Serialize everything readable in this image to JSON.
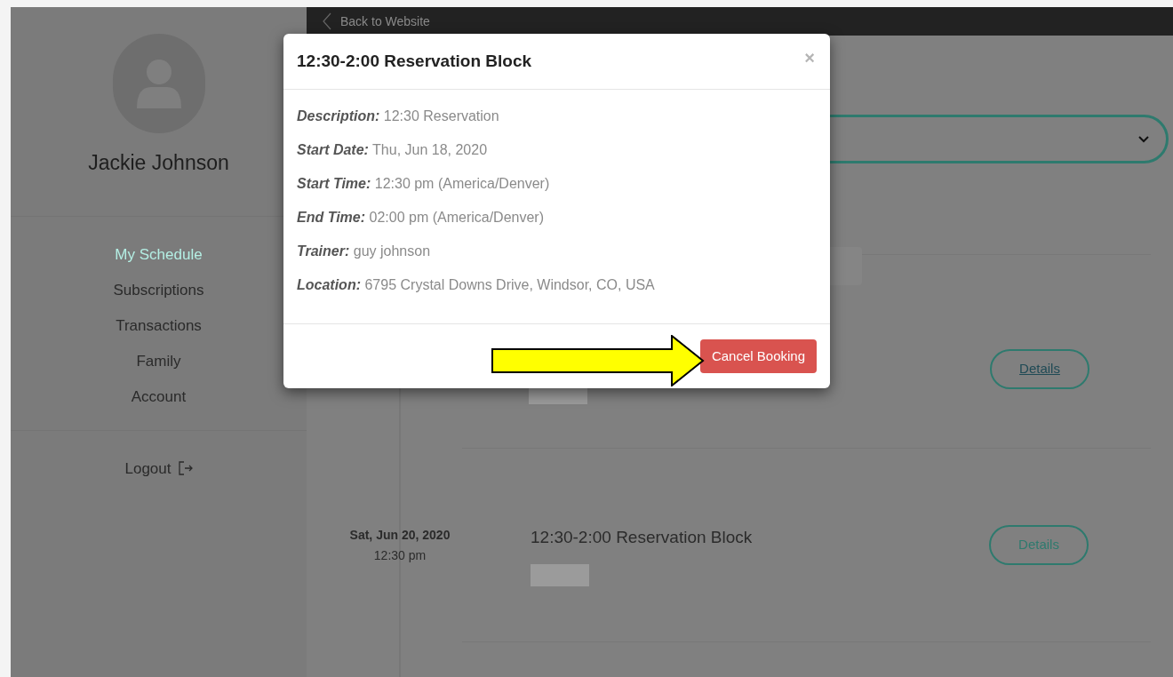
{
  "top_bar": {
    "back_link": "Back to Website"
  },
  "profile": {
    "name": "Jackie Johnson"
  },
  "nav": [
    {
      "label": "My Schedule",
      "selected": true
    },
    {
      "label": "Subscriptions",
      "selected": false
    },
    {
      "label": "Transactions",
      "selected": false
    },
    {
      "label": "Family",
      "selected": false
    },
    {
      "label": "Account",
      "selected": false
    }
  ],
  "logout": "Logout",
  "schedule": [
    {
      "details": "Details",
      "hovered": true
    },
    {
      "date": "Sat, Jun 20, 2020",
      "time": "12:30 pm",
      "title": "12:30-2:00 Reservation Block",
      "details": "Details",
      "hovered": false
    }
  ],
  "modal": {
    "title": "12:30-2:00 Reservation Block",
    "close": "×",
    "fields": [
      {
        "label": "Description:",
        "value": "12:30 Reservation"
      },
      {
        "label": "Start Date:",
        "value": "Thu, Jun 18, 2020"
      },
      {
        "label": "Start Time:",
        "value": "12:30 pm (America/Denver)"
      },
      {
        "label": "End Time:",
        "value": "02:00 pm (America/Denver)"
      },
      {
        "label": "Trainer:",
        "value": "guy johnson"
      },
      {
        "label": "Location:",
        "value": "6795 Crystal Downs Drive, Windsor, CO, USA"
      }
    ],
    "button": "Cancel Booking"
  }
}
